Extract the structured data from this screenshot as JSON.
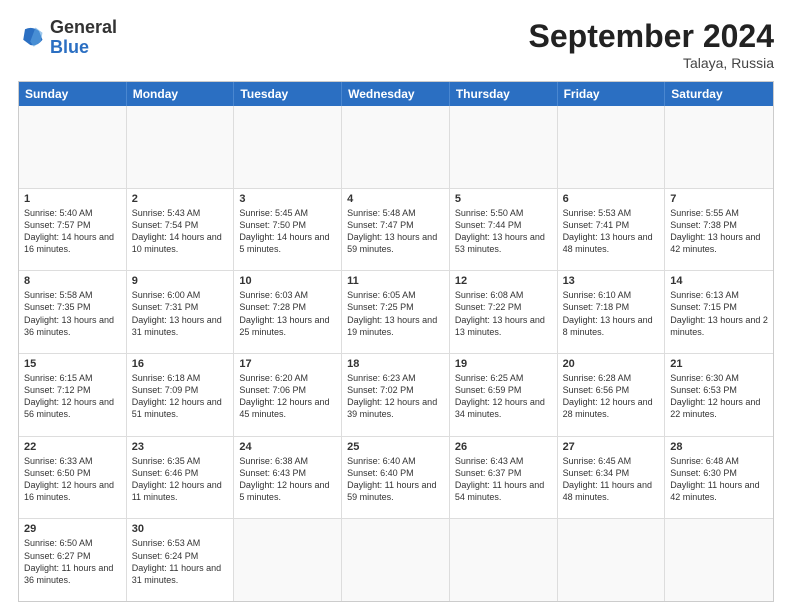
{
  "header": {
    "logo": {
      "line1": "General",
      "line2": "Blue"
    },
    "title": "September 2024",
    "location": "Talaya, Russia"
  },
  "weekdays": [
    "Sunday",
    "Monday",
    "Tuesday",
    "Wednesday",
    "Thursday",
    "Friday",
    "Saturday"
  ],
  "rows": [
    [
      {
        "day": "",
        "empty": true
      },
      {
        "day": "",
        "empty": true
      },
      {
        "day": "",
        "empty": true
      },
      {
        "day": "",
        "empty": true
      },
      {
        "day": "",
        "empty": true
      },
      {
        "day": "",
        "empty": true
      },
      {
        "day": "",
        "empty": true
      }
    ],
    [
      {
        "day": "1",
        "sunrise": "Sunrise: 5:40 AM",
        "sunset": "Sunset: 7:57 PM",
        "daylight": "Daylight: 14 hours and 16 minutes."
      },
      {
        "day": "2",
        "sunrise": "Sunrise: 5:43 AM",
        "sunset": "Sunset: 7:54 PM",
        "daylight": "Daylight: 14 hours and 10 minutes."
      },
      {
        "day": "3",
        "sunrise": "Sunrise: 5:45 AM",
        "sunset": "Sunset: 7:50 PM",
        "daylight": "Daylight: 14 hours and 5 minutes."
      },
      {
        "day": "4",
        "sunrise": "Sunrise: 5:48 AM",
        "sunset": "Sunset: 7:47 PM",
        "daylight": "Daylight: 13 hours and 59 minutes."
      },
      {
        "day": "5",
        "sunrise": "Sunrise: 5:50 AM",
        "sunset": "Sunset: 7:44 PM",
        "daylight": "Daylight: 13 hours and 53 minutes."
      },
      {
        "day": "6",
        "sunrise": "Sunrise: 5:53 AM",
        "sunset": "Sunset: 7:41 PM",
        "daylight": "Daylight: 13 hours and 48 minutes."
      },
      {
        "day": "7",
        "sunrise": "Sunrise: 5:55 AM",
        "sunset": "Sunset: 7:38 PM",
        "daylight": "Daylight: 13 hours and 42 minutes."
      }
    ],
    [
      {
        "day": "8",
        "sunrise": "Sunrise: 5:58 AM",
        "sunset": "Sunset: 7:35 PM",
        "daylight": "Daylight: 13 hours and 36 minutes."
      },
      {
        "day": "9",
        "sunrise": "Sunrise: 6:00 AM",
        "sunset": "Sunset: 7:31 PM",
        "daylight": "Daylight: 13 hours and 31 minutes."
      },
      {
        "day": "10",
        "sunrise": "Sunrise: 6:03 AM",
        "sunset": "Sunset: 7:28 PM",
        "daylight": "Daylight: 13 hours and 25 minutes."
      },
      {
        "day": "11",
        "sunrise": "Sunrise: 6:05 AM",
        "sunset": "Sunset: 7:25 PM",
        "daylight": "Daylight: 13 hours and 19 minutes."
      },
      {
        "day": "12",
        "sunrise": "Sunrise: 6:08 AM",
        "sunset": "Sunset: 7:22 PM",
        "daylight": "Daylight: 13 hours and 13 minutes."
      },
      {
        "day": "13",
        "sunrise": "Sunrise: 6:10 AM",
        "sunset": "Sunset: 7:18 PM",
        "daylight": "Daylight: 13 hours and 8 minutes."
      },
      {
        "day": "14",
        "sunrise": "Sunrise: 6:13 AM",
        "sunset": "Sunset: 7:15 PM",
        "daylight": "Daylight: 13 hours and 2 minutes."
      }
    ],
    [
      {
        "day": "15",
        "sunrise": "Sunrise: 6:15 AM",
        "sunset": "Sunset: 7:12 PM",
        "daylight": "Daylight: 12 hours and 56 minutes."
      },
      {
        "day": "16",
        "sunrise": "Sunrise: 6:18 AM",
        "sunset": "Sunset: 7:09 PM",
        "daylight": "Daylight: 12 hours and 51 minutes."
      },
      {
        "day": "17",
        "sunrise": "Sunrise: 6:20 AM",
        "sunset": "Sunset: 7:06 PM",
        "daylight": "Daylight: 12 hours and 45 minutes."
      },
      {
        "day": "18",
        "sunrise": "Sunrise: 6:23 AM",
        "sunset": "Sunset: 7:02 PM",
        "daylight": "Daylight: 12 hours and 39 minutes."
      },
      {
        "day": "19",
        "sunrise": "Sunrise: 6:25 AM",
        "sunset": "Sunset: 6:59 PM",
        "daylight": "Daylight: 12 hours and 34 minutes."
      },
      {
        "day": "20",
        "sunrise": "Sunrise: 6:28 AM",
        "sunset": "Sunset: 6:56 PM",
        "daylight": "Daylight: 12 hours and 28 minutes."
      },
      {
        "day": "21",
        "sunrise": "Sunrise: 6:30 AM",
        "sunset": "Sunset: 6:53 PM",
        "daylight": "Daylight: 12 hours and 22 minutes."
      }
    ],
    [
      {
        "day": "22",
        "sunrise": "Sunrise: 6:33 AM",
        "sunset": "Sunset: 6:50 PM",
        "daylight": "Daylight: 12 hours and 16 minutes."
      },
      {
        "day": "23",
        "sunrise": "Sunrise: 6:35 AM",
        "sunset": "Sunset: 6:46 PM",
        "daylight": "Daylight: 12 hours and 11 minutes."
      },
      {
        "day": "24",
        "sunrise": "Sunrise: 6:38 AM",
        "sunset": "Sunset: 6:43 PM",
        "daylight": "Daylight: 12 hours and 5 minutes."
      },
      {
        "day": "25",
        "sunrise": "Sunrise: 6:40 AM",
        "sunset": "Sunset: 6:40 PM",
        "daylight": "Daylight: 11 hours and 59 minutes."
      },
      {
        "day": "26",
        "sunrise": "Sunrise: 6:43 AM",
        "sunset": "Sunset: 6:37 PM",
        "daylight": "Daylight: 11 hours and 54 minutes."
      },
      {
        "day": "27",
        "sunrise": "Sunrise: 6:45 AM",
        "sunset": "Sunset: 6:34 PM",
        "daylight": "Daylight: 11 hours and 48 minutes."
      },
      {
        "day": "28",
        "sunrise": "Sunrise: 6:48 AM",
        "sunset": "Sunset: 6:30 PM",
        "daylight": "Daylight: 11 hours and 42 minutes."
      }
    ],
    [
      {
        "day": "29",
        "sunrise": "Sunrise: 6:50 AM",
        "sunset": "Sunset: 6:27 PM",
        "daylight": "Daylight: 11 hours and 36 minutes."
      },
      {
        "day": "30",
        "sunrise": "Sunrise: 6:53 AM",
        "sunset": "Sunset: 6:24 PM",
        "daylight": "Daylight: 11 hours and 31 minutes."
      },
      {
        "day": "",
        "empty": true
      },
      {
        "day": "",
        "empty": true
      },
      {
        "day": "",
        "empty": true
      },
      {
        "day": "",
        "empty": true
      },
      {
        "day": "",
        "empty": true
      }
    ]
  ]
}
